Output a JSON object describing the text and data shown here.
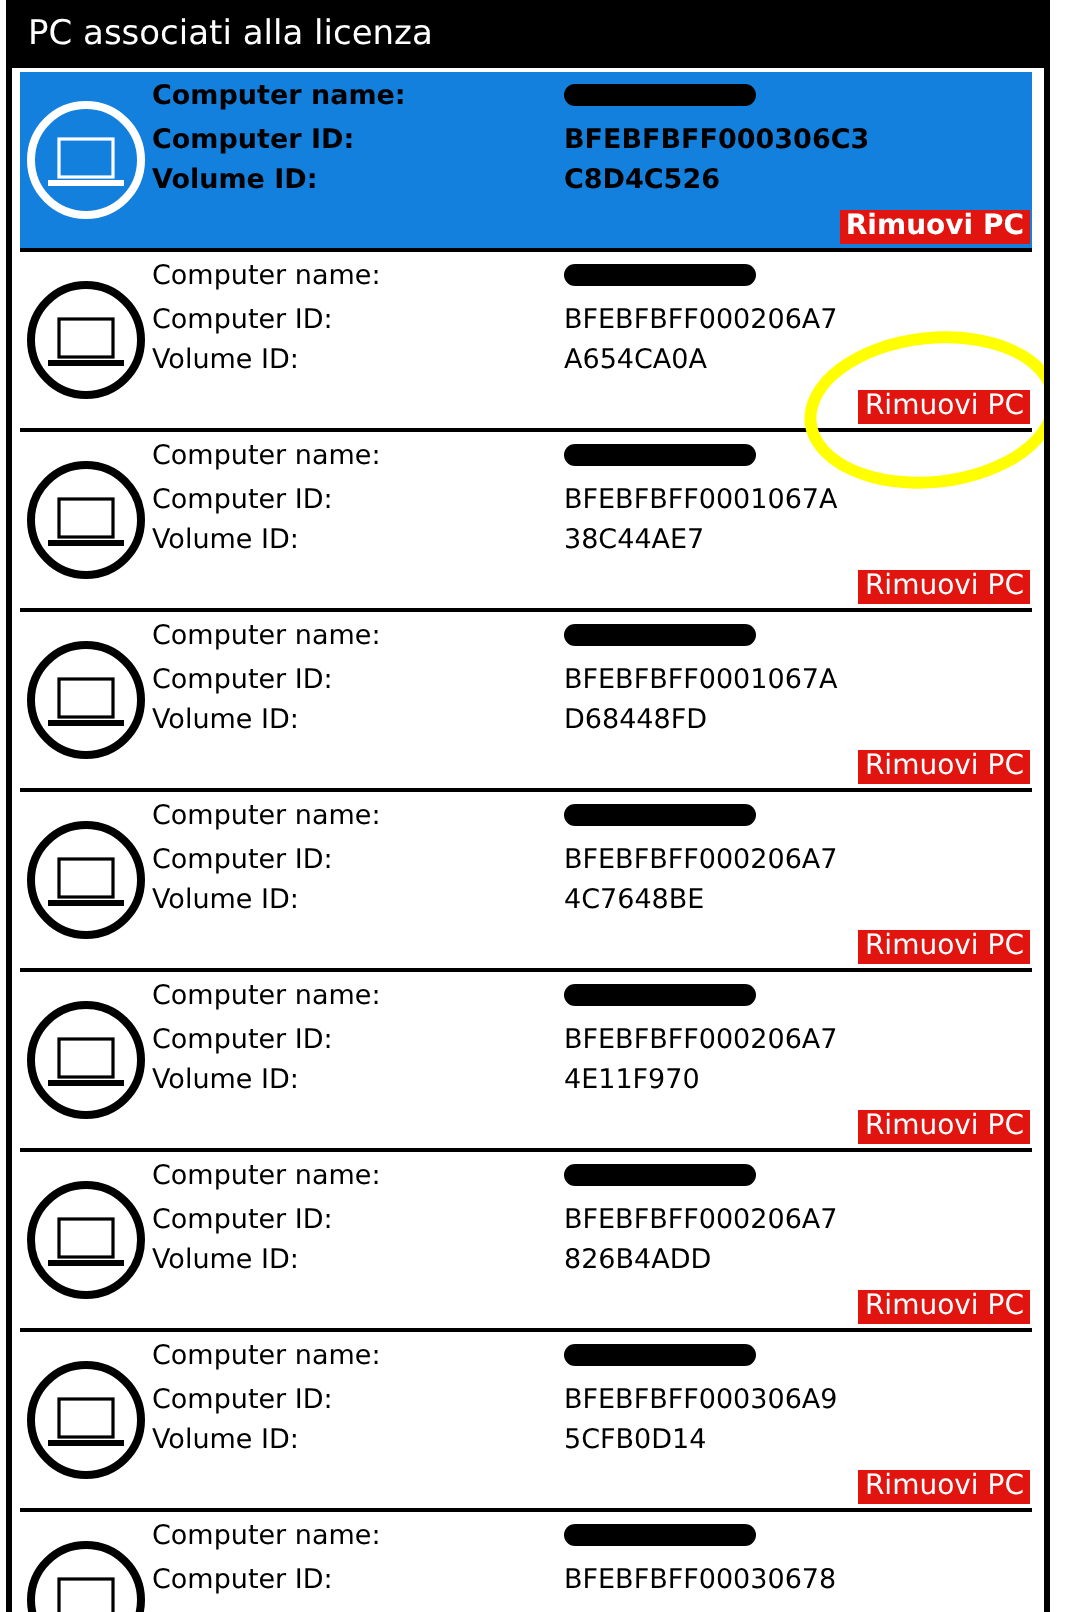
{
  "window": {
    "title": "PC associati alla licenza"
  },
  "rows": [
    {
      "selected": true,
      "name_label": "Computer name:",
      "name_redacted": true,
      "computer_id_label": "Computer ID:",
      "computer_id": "BFEBFBFF000306C3",
      "volume_id_label": "Volume ID:",
      "volume_id": "C8D4C526",
      "button": "Rimuovi PC",
      "highlighted": false
    },
    {
      "selected": false,
      "name_label": "Computer name:",
      "name_redacted": true,
      "computer_id_label": "Computer ID:",
      "computer_id": "BFEBFBFF000206A7",
      "volume_id_label": "Volume ID:",
      "volume_id": "A654CA0A",
      "button": "Rimuovi PC",
      "highlighted": true
    },
    {
      "selected": false,
      "name_label": "Computer name:",
      "name_redacted": true,
      "computer_id_label": "Computer ID:",
      "computer_id": "BFEBFBFF0001067A",
      "volume_id_label": "Volume ID:",
      "volume_id": "38C44AE7",
      "button": "Rimuovi PC",
      "highlighted": false
    },
    {
      "selected": false,
      "name_label": "Computer name:",
      "name_redacted": true,
      "computer_id_label": "Computer ID:",
      "computer_id": "BFEBFBFF0001067A",
      "volume_id_label": "Volume ID:",
      "volume_id": "D68448FD",
      "button": "Rimuovi PC",
      "highlighted": false
    },
    {
      "selected": false,
      "name_label": "Computer name:",
      "name_redacted": true,
      "computer_id_label": "Computer ID:",
      "computer_id": "BFEBFBFF000206A7",
      "volume_id_label": "Volume ID:",
      "volume_id": "4C7648BE",
      "button": "Rimuovi PC",
      "highlighted": false
    },
    {
      "selected": false,
      "name_label": "Computer name:",
      "name_redacted": true,
      "computer_id_label": "Computer ID:",
      "computer_id": "BFEBFBFF000206A7",
      "volume_id_label": "Volume ID:",
      "volume_id": "4E11F970",
      "button": "Rimuovi PC",
      "highlighted": false
    },
    {
      "selected": false,
      "name_label": "Computer name:",
      "name_redacted": true,
      "computer_id_label": "Computer ID:",
      "computer_id": "BFEBFBFF000206A7",
      "volume_id_label": "Volume ID:",
      "volume_id": "826B4ADD",
      "button": "Rimuovi PC",
      "highlighted": false
    },
    {
      "selected": false,
      "name_label": "Computer name:",
      "name_redacted": true,
      "computer_id_label": "Computer ID:",
      "computer_id": "BFEBFBFF000306A9",
      "volume_id_label": "Volume ID:",
      "volume_id": "5CFB0D14",
      "button": "Rimuovi PC",
      "highlighted": false
    },
    {
      "selected": false,
      "name_label": "Computer name:",
      "name_redacted": true,
      "computer_id_label": "Computer ID:",
      "computer_id": "BFEBFBFF00030678",
      "highlighted": false
    }
  ]
}
